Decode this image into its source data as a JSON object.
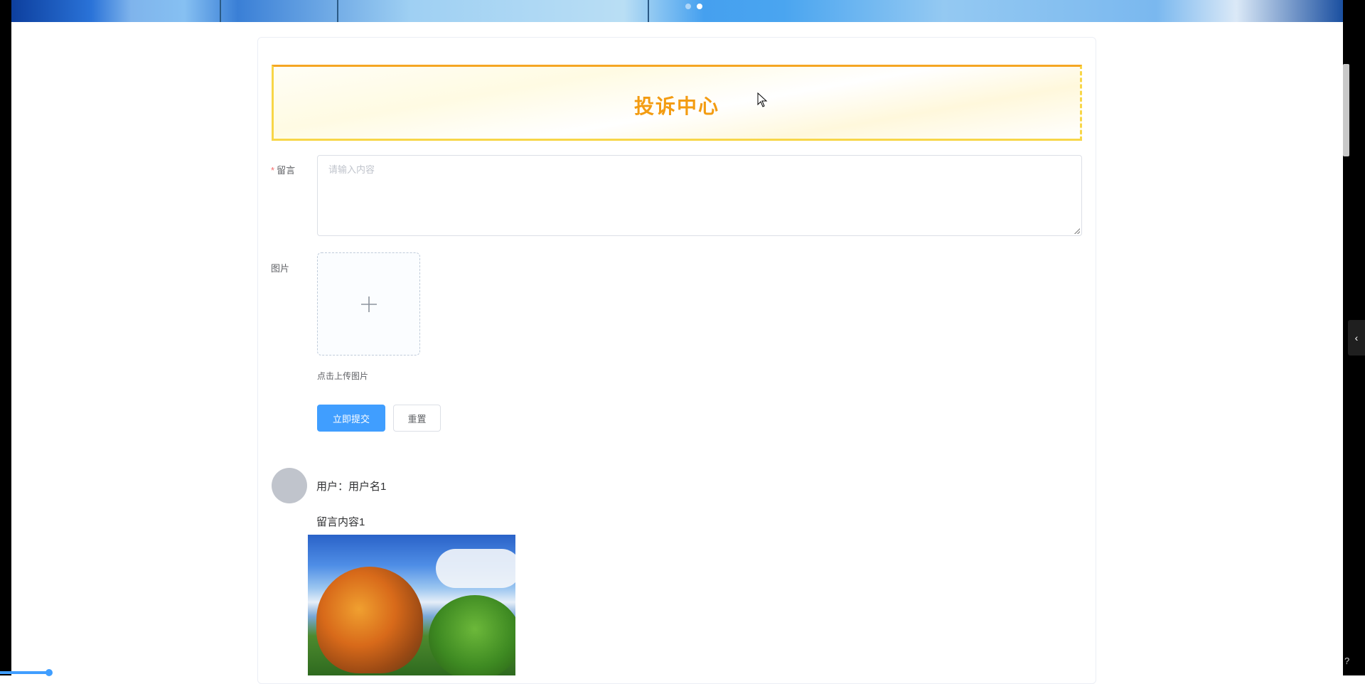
{
  "carousel": {
    "active_index": 1
  },
  "banner": {
    "title": "投诉中心"
  },
  "form": {
    "message_label": "留言",
    "message_placeholder": "请输入内容",
    "image_label": "图片",
    "upload_tip": "点击上传图片",
    "submit_label": "立即提交",
    "reset_label": "重置"
  },
  "comments": [
    {
      "user": "用户：用户名1",
      "content": "留言内容1"
    }
  ],
  "side_tab": {
    "icon": "chevron-left-icon"
  },
  "colors": {
    "primary": "#409eff",
    "banner_title": "#f39c12",
    "banner_border": "#f8d648"
  }
}
